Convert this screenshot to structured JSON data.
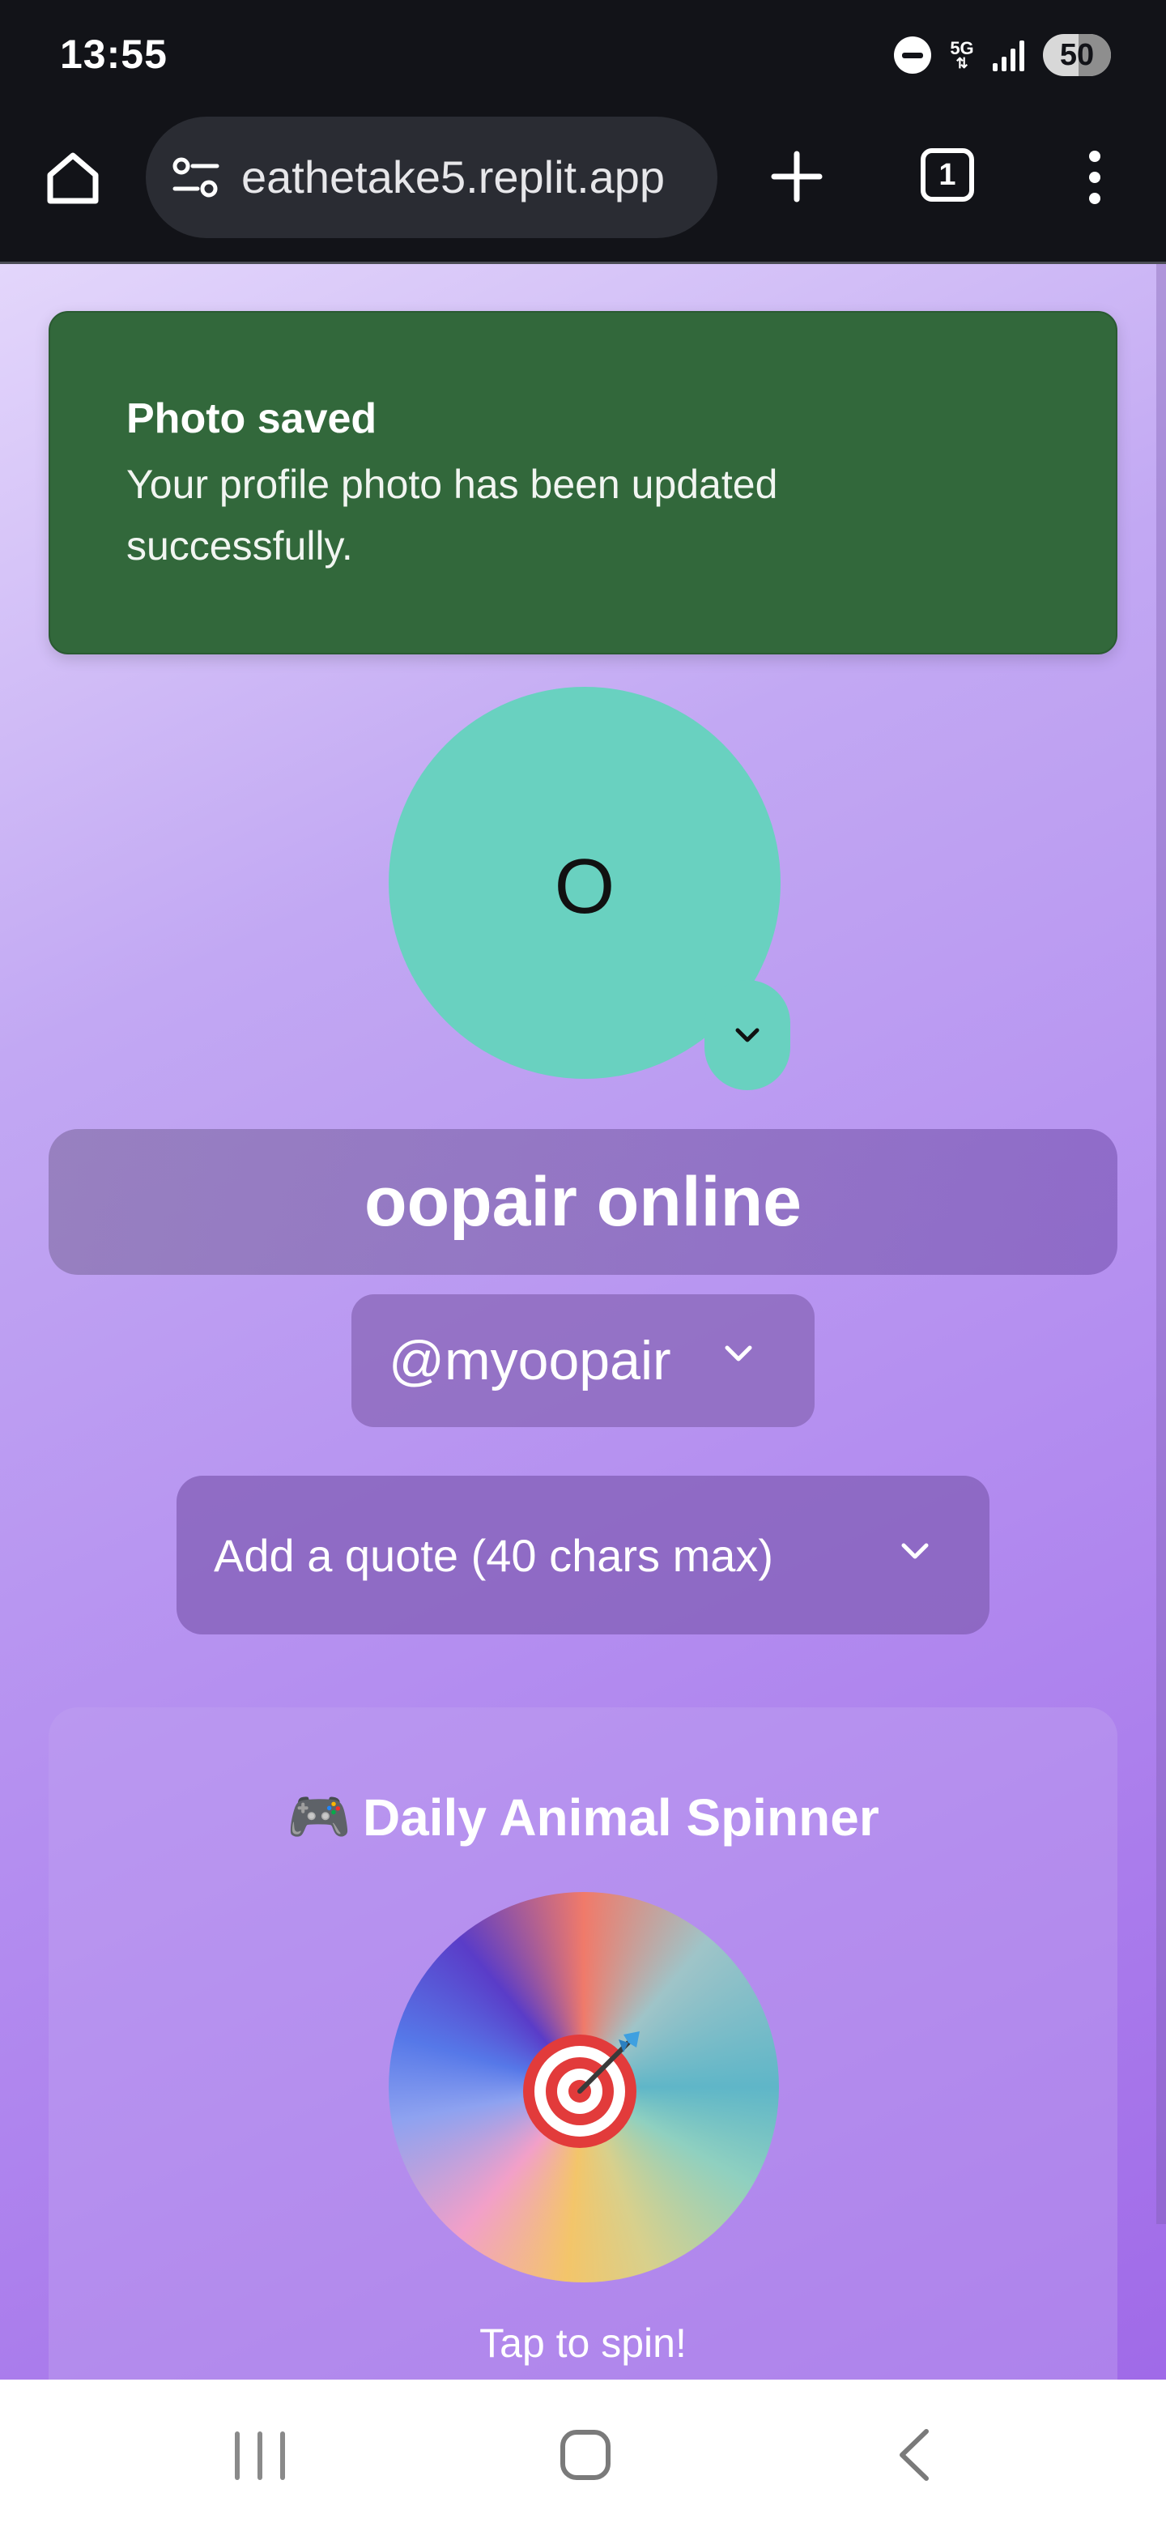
{
  "status_bar": {
    "time": "13:55",
    "network": "5G",
    "battery": "50",
    "icons": [
      "do-not-disturb-icon",
      "5g-icon",
      "signal-icon",
      "battery-icon"
    ]
  },
  "browser": {
    "url": "eathetake5.replit.app",
    "tab_count": "1",
    "icons": [
      "home-icon",
      "site-settings-icon",
      "new-tab-icon",
      "tabs-icon",
      "more-menu-icon"
    ]
  },
  "toast": {
    "title": "Photo saved",
    "message": "Your profile photo has been updated successfully.",
    "background": "#32683b"
  },
  "profile": {
    "avatar_initial": "O",
    "avatar_color": "#69d1c0",
    "display_name": "oopair online",
    "handle": "@myoopair",
    "quote_placeholder": "Add a quote (40 chars max)"
  },
  "spinner": {
    "emoji": "🎮",
    "title": "Daily Animal Spinner",
    "center_icon": "target-icon",
    "cta": "Tap to spin!"
  },
  "nav_bar": {
    "icons": [
      "recent-apps-icon",
      "home-nav-icon",
      "back-icon"
    ]
  }
}
